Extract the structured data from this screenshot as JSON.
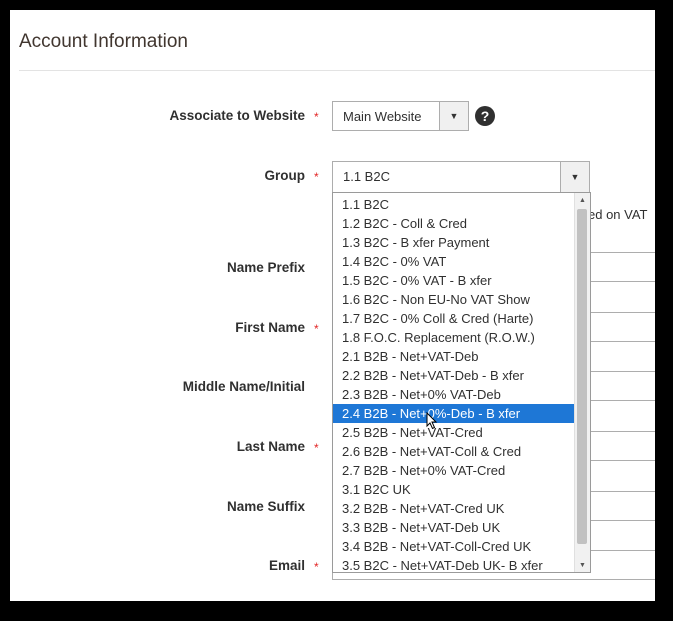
{
  "section": {
    "title": "Account Information"
  },
  "form": {
    "associate_website": {
      "label": "Associate to Website",
      "value": "Main Website"
    },
    "group": {
      "label": "Group",
      "value": "1.1 B2C",
      "side_text": "ed on VAT",
      "options": [
        "1.1 B2C",
        "1.2 B2C - Coll & Cred",
        "1.3 B2C - B xfer Payment",
        "1.4 B2C - 0% VAT",
        "1.5 B2C - 0% VAT - B xfer",
        "1.6 B2C - Non EU-No VAT Show",
        "1.7 B2C - 0% Coll & Cred (Harte)",
        "1.8 F.O.C. Replacement (R.O.W.)",
        "2.1 B2B - Net+VAT-Deb",
        "2.2 B2B - Net+VAT-Deb - B xfer",
        "2.3 B2B - Net+0% VAT-Deb",
        "2.4 B2B - Net+0%-Deb - B xfer",
        "2.5 B2B - Net+VAT-Cred",
        "2.6 B2B - Net+VAT-Coll & Cred",
        "2.7 B2B - Net+0% VAT-Cred",
        "3.1 B2C UK",
        "3.2 B2B - Net+VAT-Cred UK",
        "3.3 B2B - Net+VAT-Deb UK",
        "3.4 B2B - Net+VAT-Coll-Cred UK",
        "3.5 B2C - Net+VAT-Deb UK- B xfer"
      ],
      "highlighted_index": 11
    },
    "name_prefix": {
      "label": "Name Prefix"
    },
    "first_name": {
      "label": "First Name"
    },
    "middle_name": {
      "label": "Middle Name/Initial"
    },
    "last_name": {
      "label": "Last Name"
    },
    "name_suffix": {
      "label": "Name Suffix"
    },
    "email": {
      "label": "Email"
    },
    "required_mark": "*",
    "help_symbol": "?"
  },
  "icons": {
    "dropdown_arrow": "chevron-down-icon",
    "help": "question-icon",
    "cursor": "pointer-cursor-icon"
  },
  "colors": {
    "highlight": "#1e77d6",
    "required": "#e22626",
    "title": "#41362f"
  }
}
